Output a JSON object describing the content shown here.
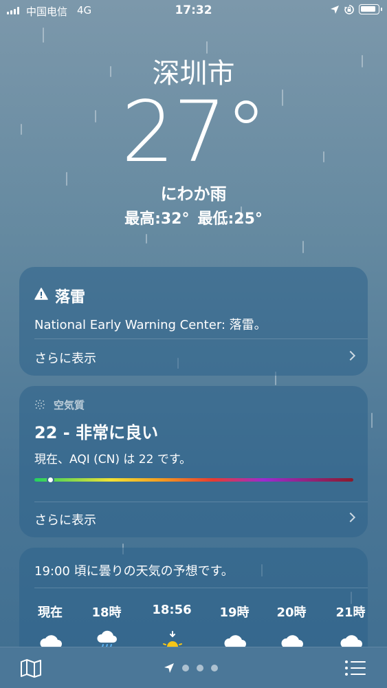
{
  "status_bar": {
    "carrier": "中国电信",
    "network": "4G",
    "time": "17:32",
    "icons": [
      "cellular-signal-icon",
      "location-icon",
      "rotation-lock-icon",
      "battery-icon"
    ]
  },
  "current": {
    "city": "深圳市",
    "temperature": "27°",
    "condition": "にわか雨",
    "high": "最高:32°",
    "low": "最低:25°"
  },
  "alert_card": {
    "icon": "warning-triangle-icon",
    "title": "落雷",
    "description": "National Early Warning Center: 落雷。",
    "more_label": "さらに表示"
  },
  "aqi_card": {
    "icon": "air-quality-icon",
    "label": "空気質",
    "value": "22 - 非常に良い",
    "description": "現在、AQI (CN) は 22 です。",
    "scale_position": 0.05,
    "more_label": "さらに表示",
    "scale_colors": [
      "#23d160",
      "#f2e234",
      "#f39a20",
      "#e83b2f",
      "#9b2bd0",
      "#8b1a2a"
    ]
  },
  "hourly_card": {
    "summary": "19:00 頃に曇りの天気の予想です。",
    "hours": [
      {
        "label": "現在",
        "icon": "cloud-icon"
      },
      {
        "label": "18時",
        "icon": "cloud-rain-icon"
      },
      {
        "label": "18:56",
        "icon": "sunset-icon"
      },
      {
        "label": "19時",
        "icon": "cloud-icon"
      },
      {
        "label": "20時",
        "icon": "cloud-icon"
      },
      {
        "label": "21時",
        "icon": "cloud-icon"
      }
    ]
  },
  "bottom_bar": {
    "map_icon": "map-icon",
    "location_icon": "location-arrow-icon",
    "page_dots": 3,
    "list_icon": "list-icon"
  }
}
